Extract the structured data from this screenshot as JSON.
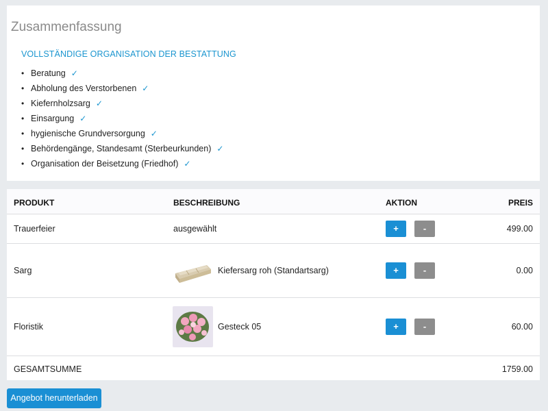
{
  "summary": {
    "title": "Zusammenfassung",
    "subtitle": "VOLLSTÄNDIGE ORGANISATION DER BESTATTUNG",
    "items": [
      "Beratung",
      "Abholung des Verstorbenen",
      "Kiefernholzsarg",
      "Einsargung",
      "hygienische Grundversorgung",
      "Behördengänge, Standesamt (Sterbeurkunden)",
      "Organisation der Beisetzung (Friedhof)"
    ],
    "check_glyph": "✓",
    "bullet_glyph": "•"
  },
  "table": {
    "headers": {
      "product": "PRODUKT",
      "description": "BESCHREIBUNG",
      "action": "AKTION",
      "price": "PREIS"
    },
    "rows": [
      {
        "product": "Trauerfeier",
        "description": "ausgewählt",
        "price": "499.00",
        "image": ""
      },
      {
        "product": "Sarg",
        "description": "Kiefersarg roh (Standartsarg)",
        "price": "0.00",
        "image": "coffin-image"
      },
      {
        "product": "Floristik",
        "description": "Gesteck 05",
        "price": "60.00",
        "image": "flower-arrangement-image"
      }
    ],
    "plus_label": "+",
    "minus_label": "-",
    "total_label": "GESAMTSUMME",
    "total_value": "1759.00"
  },
  "download_label": "Angebot herunterladen",
  "colors": {
    "accent": "#1a8fd4",
    "check": "#1a95cf",
    "minus_button": "#8d8d8d",
    "background": "#e8ebee"
  }
}
